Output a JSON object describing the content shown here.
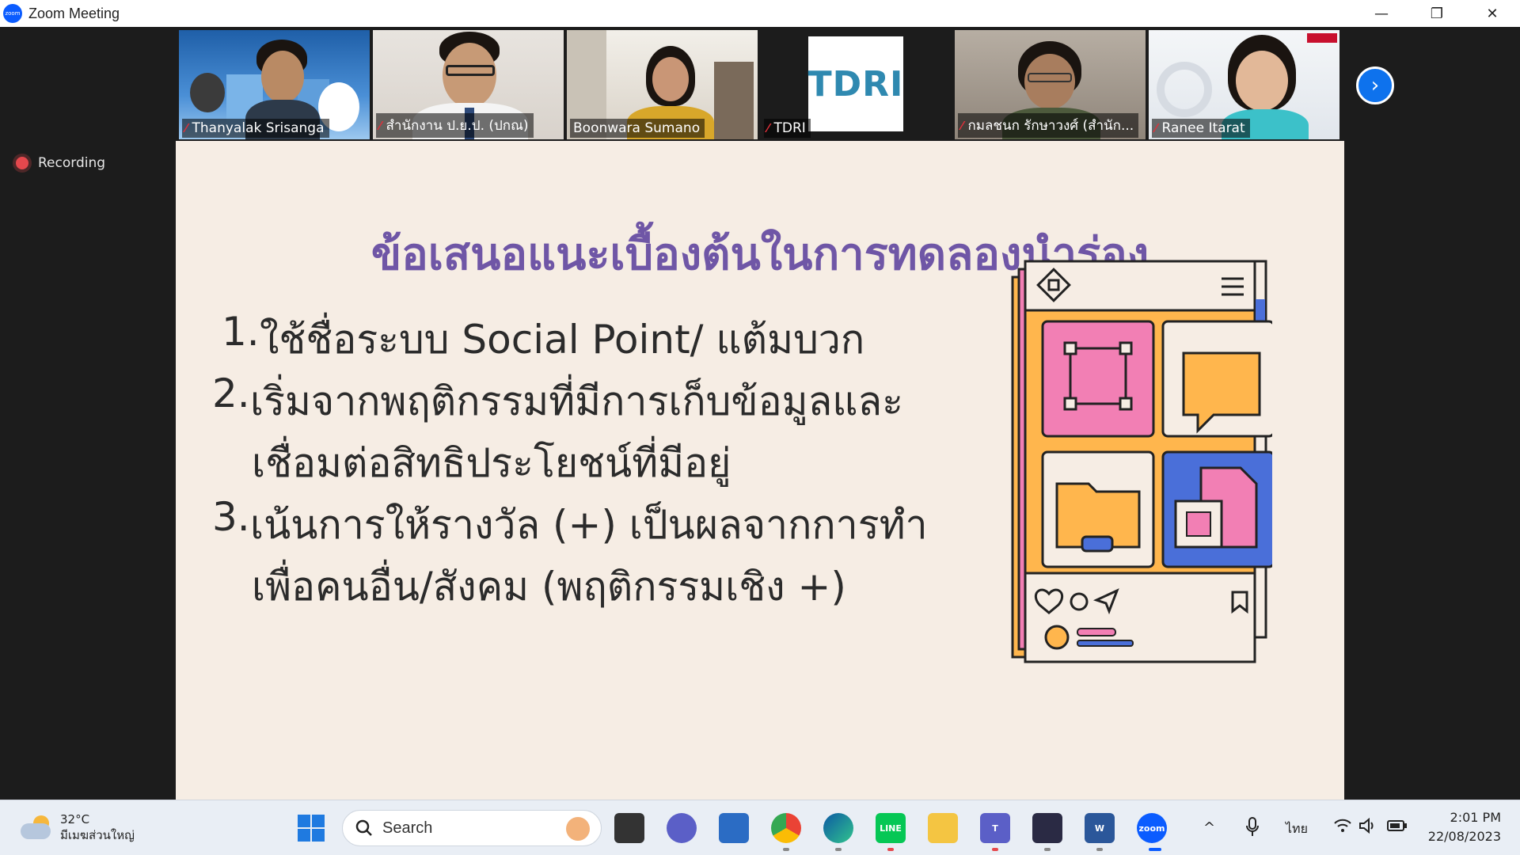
{
  "window": {
    "title": "Zoom Meeting",
    "logo_text": "zoom",
    "controls": {
      "minimize": "—",
      "restore": "❐",
      "close": "✕"
    }
  },
  "participants": [
    {
      "name": "Thanyalak Srisanga",
      "muted": true
    },
    {
      "name": "สำนักงาน ป.ย.ป. (ปกณ)",
      "muted": true
    },
    {
      "name": "Boonwara Sumano",
      "muted": false,
      "active_speaker": true
    },
    {
      "name": "TDRI",
      "muted": true,
      "logo_text": "TDRI"
    },
    {
      "name": "กมลชนก รักษาวงศ์ (สำนัก...",
      "muted": true
    },
    {
      "name": "Ranee Itarat",
      "muted": true
    }
  ],
  "recording_label": "Recording",
  "slide": {
    "title": "ข้อเสนอแนะเบื้องต้นในการทดลองนำร่อง",
    "points": [
      {
        "num": "1.",
        "text": "ใช้ชื่อระบบ Social Point/ แต้มบวก"
      },
      {
        "num": "2.",
        "text": "เริ่มจากพฤติกรรมที่มีการเก็บข้อมูลและ",
        "cont": "เชื่อมต่อสิทธิประโยชน์ที่มีอยู่"
      },
      {
        "num": "3.",
        "text": "เน้นการให้รางวัล (+) เป็นผลจากการทำ",
        "cont": "เพื่อคนอื่น/สังคม (พฤติกรรมเชิง +)"
      }
    ],
    "colors": {
      "title": "#6f56a6",
      "background": "#f6ede4",
      "orange": "#ffb64d",
      "pink": "#f27fb4",
      "blue": "#4a6fd9"
    }
  },
  "taskbar": {
    "weather": {
      "temp": "32°C",
      "desc": "มีเมฆส่วนใหญ่"
    },
    "search_placeholder": "Search",
    "language": "ไทย",
    "time": "2:01 PM",
    "date": "22/08/2023",
    "apps": [
      "start-icon",
      "search-input",
      "task-view-icon",
      "chat-icon",
      "store-icon",
      "chrome-icon",
      "edge-icon",
      "line-icon",
      "explorer-icon",
      "teams-icon",
      "clipchamp-icon",
      "word-icon",
      "zoom-icon"
    ]
  }
}
